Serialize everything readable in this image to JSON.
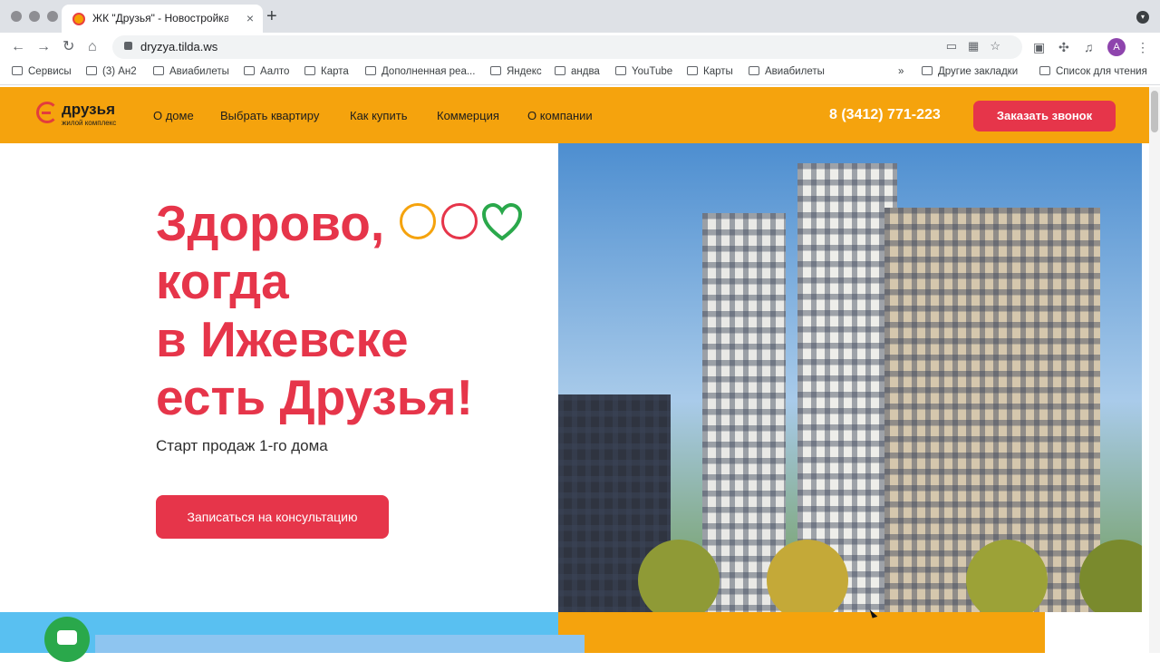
{
  "browser": {
    "tab_title": "ЖК \"Друзья\" - Новостройка",
    "url": "dryzya.tilda.ws",
    "avatar_letter": "A",
    "bookmarks": [
      {
        "label": "Сервисы",
        "icon": "apps-icon"
      },
      {
        "label": "(3) Ан2",
        "icon": "chat-icon"
      },
      {
        "label": "Авиабилеты",
        "icon": "plane-icon"
      },
      {
        "label": "Аалто",
        "icon": "folder-icon"
      },
      {
        "label": "Карта",
        "icon": "folder-icon"
      },
      {
        "label": "Дополненная реа...",
        "icon": "folder-icon"
      },
      {
        "label": "Яндекс",
        "icon": "yandex-icon"
      },
      {
        "label": "андва",
        "icon": "folder-icon"
      },
      {
        "label": "YouTube",
        "icon": "youtube-icon"
      },
      {
        "label": "Карты",
        "icon": "maps-icon"
      },
      {
        "label": "Авиабилеты",
        "icon": "globe-icon"
      }
    ],
    "overflow": "»",
    "other_bookmarks": "Другие закладки",
    "reading_list": "Список для чтения"
  },
  "site": {
    "logo_name": "друзья",
    "logo_subtitle": "жилой комплекс",
    "menu": [
      "О доме",
      "Выбрать квартиру",
      "Как купить",
      "Коммерция",
      "О компании"
    ],
    "phone": "8 (3412) 771-223",
    "call_button": "Заказать звонок"
  },
  "hero": {
    "headline_lines": [
      "Здорово,",
      "когда",
      "в Ижевске",
      "есть Друзья!"
    ],
    "subtitle": "Старт продаж 1-го дома",
    "cta": "Записаться на консультацию"
  },
  "colors": {
    "accent": "#e6354a",
    "header": "#f5a30d",
    "lower_blue": "#59c0f1",
    "emoji_smile": "#f5a30d",
    "emoji_ball": "#e6354a",
    "emoji_heart": "#2aa84b"
  }
}
